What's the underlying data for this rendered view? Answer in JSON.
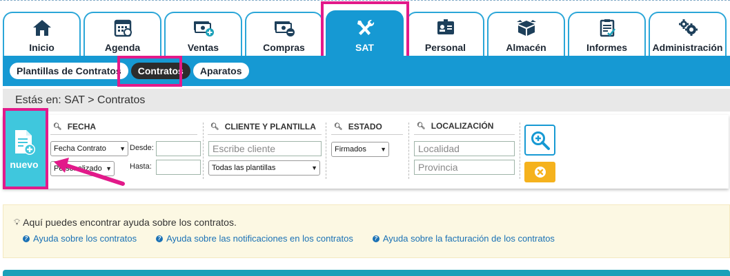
{
  "tabs": [
    {
      "label": "Inicio",
      "icon": "home-icon"
    },
    {
      "label": "Agenda",
      "icon": "calendar-icon"
    },
    {
      "label": "Ventas",
      "icon": "money-plus-icon"
    },
    {
      "label": "Compras",
      "icon": "money-minus-icon"
    },
    {
      "label": "SAT",
      "icon": "tools-icon"
    },
    {
      "label": "Personal",
      "icon": "id-card-icon"
    },
    {
      "label": "Almacén",
      "icon": "boxes-icon"
    },
    {
      "label": "Informes",
      "icon": "clipboard-icon"
    },
    {
      "label": "Administración",
      "icon": "gears-icon"
    }
  ],
  "active_tab": "SAT",
  "subnav": [
    {
      "label": "Plantillas de Contratos"
    },
    {
      "label": "Contratos"
    },
    {
      "label": "Aparatos"
    }
  ],
  "active_subnav": "Contratos",
  "breadcrumb": "Estás en: SAT > Contratos",
  "nuevo_label": "nuevo",
  "filters": {
    "fecha": {
      "title": "FECHA",
      "date_type": "Fecha Contrato",
      "period": "Personalizado",
      "desde_label": "Desde:",
      "hasta_label": "Hasta:"
    },
    "cliente": {
      "title": "CLIENTE Y PLANTILLA",
      "placeholder": "Escribe cliente",
      "plantilla": "Todas las plantillas"
    },
    "estado": {
      "title": "ESTADO",
      "value": "Firmados"
    },
    "localizacion": {
      "title": "LOCALIZACIÓN",
      "localidad_placeholder": "Localidad",
      "provincia_placeholder": "Provincia"
    }
  },
  "help": {
    "title": "Aquí puedes encontrar ayuda sobre los contratos.",
    "links": [
      "Ayuda sobre los contratos",
      "Ayuda sobre las notificaciones en los contratos",
      "Ayuda sobre la facturación de los contratos"
    ]
  },
  "colors": {
    "primary": "#1699d3",
    "highlight": "#e21a8a",
    "nuevo": "#3fc7dd",
    "clear_button": "#f5b21d",
    "help_bg": "#fcf8e3",
    "link": "#1a71b5"
  }
}
